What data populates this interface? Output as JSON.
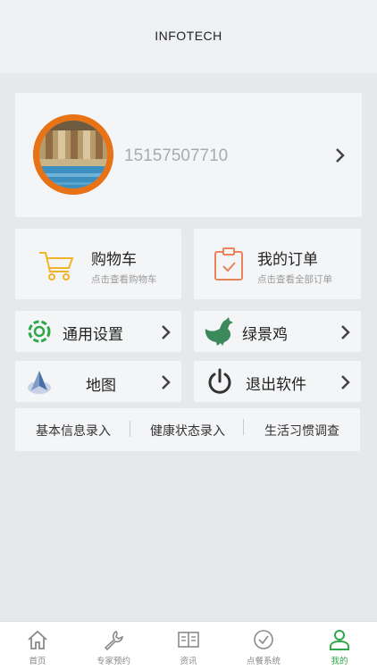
{
  "header": {
    "title": "INFOTECH"
  },
  "profile": {
    "phone": "15157507710",
    "avatar_icon": "avatar-photo-icon"
  },
  "tiles": {
    "cart": {
      "label": "购物车",
      "sub": "点击查看购物车",
      "icon": "cart-icon"
    },
    "orders": {
      "label": "我的订单",
      "sub": "点击查看全部订单",
      "icon": "clipboard-icon"
    },
    "settings": {
      "label": "通用设置",
      "icon": "gear-icon"
    },
    "chicken": {
      "label": "绿景鸡",
      "icon": "chicken-icon"
    },
    "map": {
      "label": "地图",
      "icon": "compass-icon"
    },
    "exit": {
      "label": "退出软件",
      "icon": "power-icon"
    }
  },
  "links": [
    "基本信息录入",
    "健康状态录入",
    "生活习惯调查"
  ],
  "tabbar": {
    "active": "我的",
    "tabs": [
      {
        "label": "首页",
        "icon": "home-icon"
      },
      {
        "label": "专家预约",
        "icon": "wrench-icon"
      },
      {
        "label": "资讯",
        "icon": "book-icon"
      },
      {
        "label": "点餐系统",
        "icon": "clock-icon"
      },
      {
        "label": "我的",
        "icon": "person-icon"
      }
    ]
  },
  "colors": {
    "accent": "#2fa84a",
    "orange": "#e87317",
    "cart_yellow": "#f0b329",
    "tab_inactive": "#8a8a8a"
  }
}
